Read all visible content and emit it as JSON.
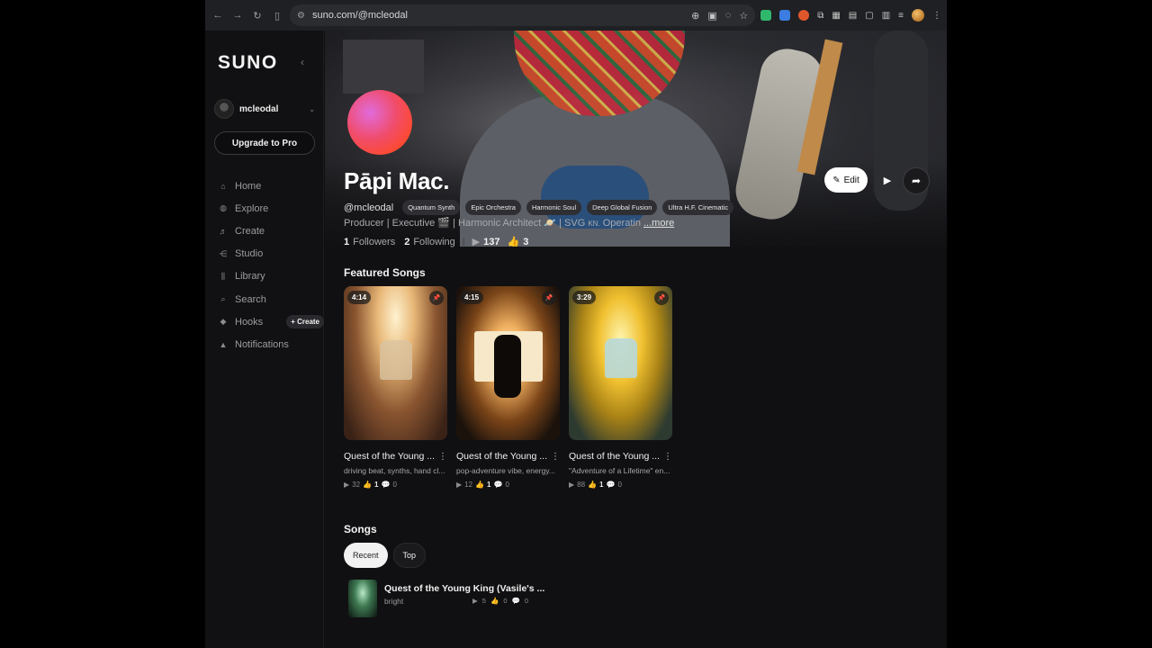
{
  "browser": {
    "url": "suno.com/@mcleodal"
  },
  "sidebar": {
    "logo": "SUNO",
    "username": "mcleodal",
    "upgrade_label": "Upgrade to Pro",
    "items": [
      {
        "label": "Home",
        "icon": "home-icon"
      },
      {
        "label": "Explore",
        "icon": "compass-icon"
      },
      {
        "label": "Create",
        "icon": "music-note-icon"
      },
      {
        "label": "Studio",
        "icon": "studio-icon"
      },
      {
        "label": "Library",
        "icon": "library-icon"
      },
      {
        "label": "Search",
        "icon": "search-icon"
      },
      {
        "label": "Hooks",
        "icon": "hooks-icon"
      },
      {
        "label": "Notifications",
        "icon": "bell-icon"
      }
    ],
    "hooks_create_label": "+ Create"
  },
  "profile": {
    "name": "Pāpi Mac.",
    "handle": "@mcleodal",
    "tags": [
      "Quantum Synth",
      "Epic Orchestra",
      "Harmonic Soul",
      "Deep Global Fusion",
      "Ultra H.F. Cinematic"
    ],
    "bio": "Producer | Executive 🎬 | Harmonic Architect 🪐 | SVG ",
    "bio_kn": "KN.",
    "bio_rest": " Operatin",
    "more_label": "...more",
    "followers_count": "1",
    "followers_label": "Followers",
    "following_count": "2",
    "following_label": "Following",
    "plays": "137",
    "likes": "3",
    "edit_label": "Edit"
  },
  "featured": {
    "title": "Featured Songs",
    "songs": [
      {
        "duration": "4:14",
        "title": "Quest of the Young ...",
        "desc": "driving beat, synths, hand cl...",
        "plays": "32",
        "likes": "1",
        "comments": "0"
      },
      {
        "duration": "4:15",
        "title": "Quest of the Young ...",
        "desc": "pop-adventure vibe, energy...",
        "plays": "12",
        "likes": "1",
        "comments": "0"
      },
      {
        "duration": "3:29",
        "title": "Quest of the Young ...",
        "desc": "\"Adventure of a Lifetime\" en...",
        "plays": "88",
        "likes": "1",
        "comments": "0"
      }
    ]
  },
  "songs": {
    "title": "Songs",
    "tabs": [
      "Recent",
      "Top"
    ],
    "list": [
      {
        "title": "Quest of the Young King (Vasile's ...",
        "tag": "bright",
        "plays": "5",
        "likes": "0",
        "comments": "0"
      }
    ]
  }
}
